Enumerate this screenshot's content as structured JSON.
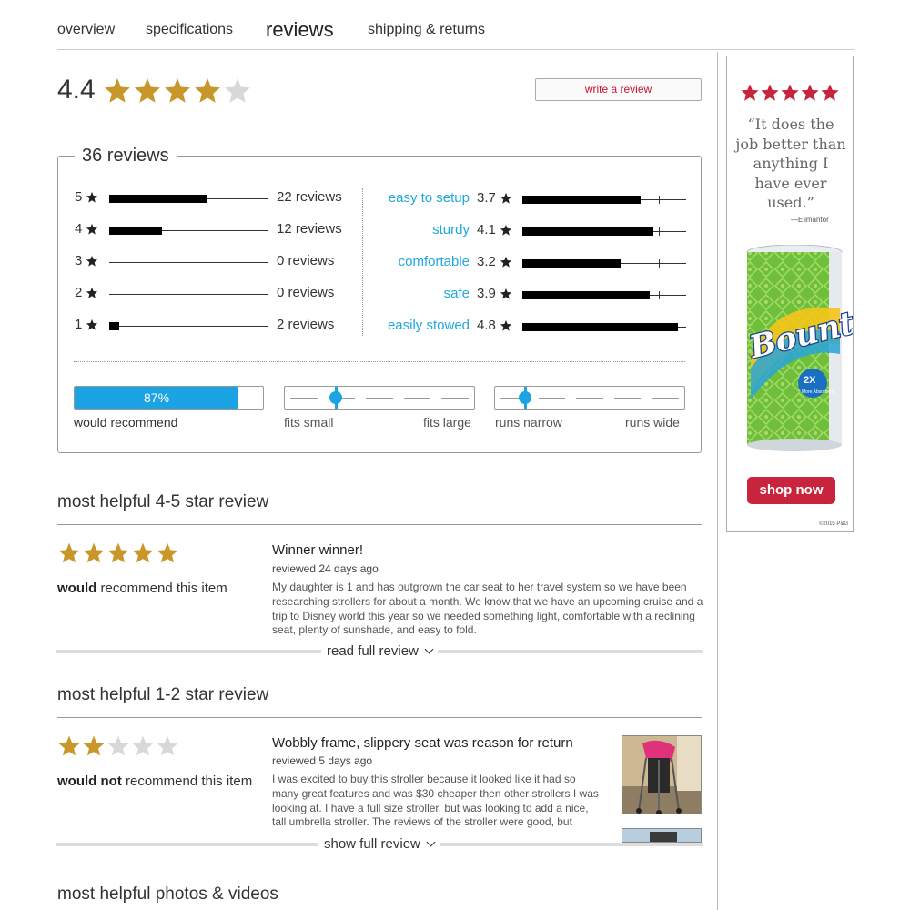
{
  "tabs": [
    "overview",
    "specifications",
    "reviews",
    "shipping & returns"
  ],
  "summary": {
    "average": "4.4",
    "rating": 4,
    "write_review": "write a review"
  },
  "box": {
    "title": "36 reviews",
    "histogram": [
      {
        "stars": "5",
        "count_label": "22 reviews",
        "fraction": 0.61
      },
      {
        "stars": "4",
        "count_label": "12 reviews",
        "fraction": 0.33
      },
      {
        "stars": "3",
        "count_label": "0 reviews",
        "fraction": 0
      },
      {
        "stars": "2",
        "count_label": "0 reviews",
        "fraction": 0
      },
      {
        "stars": "1",
        "count_label": "2 reviews",
        "fraction": 0.06
      }
    ],
    "attributes": [
      {
        "label": "easy to setup",
        "value": "3.7",
        "fraction": 0.72
      },
      {
        "label": "sturdy",
        "value": "4.1",
        "fraction": 0.8
      },
      {
        "label": "comfortable",
        "value": "3.2",
        "fraction": 0.6
      },
      {
        "label": "safe",
        "value": "3.9",
        "fraction": 0.78
      },
      {
        "label": "easily stowed",
        "value": "4.8",
        "fraction": 0.95
      }
    ],
    "recommend": {
      "percent": "87%",
      "fraction": 0.87,
      "label": "would recommend"
    },
    "fit": {
      "left": "fits small",
      "right": "fits large",
      "position": 0.27
    },
    "width": {
      "left": "runs narrow",
      "right": "runs wide",
      "position": 0.16
    }
  },
  "positive_review": {
    "section_title": "most helpful 4-5 star review",
    "rating": 5,
    "recommend_bold": "would",
    "recommend_rest": " recommend this item",
    "title": "Winner winner!",
    "date": "reviewed 24 days ago",
    "body": "My daughter is 1 and has outgrown the car seat to her travel system so we have been researching strollers for about a month. We know that we have an upcoming cruise and a trip to Disney world this year so we needed something light, comfortable with a reclining seat, plenty of sunshade, and easy to fold.",
    "read_more": "read full review"
  },
  "negative_review": {
    "section_title": "most helpful 1-2 star review",
    "rating": 2,
    "recommend_bold": "would not",
    "recommend_rest": " recommend this item",
    "title": "Wobbly frame, slippery seat was reason for return",
    "date": "reviewed 5 days ago",
    "body": "I was excited to buy this stroller because it looked like it had so many great features and was $30 cheaper then other strollers I was looking at. I have a full size stroller, but was looking to add a nice, tall umbrella stroller. The reviews of the stroller were good, but",
    "read_more": "show full review"
  },
  "photos_section": {
    "title": "most helpful photos & videos"
  },
  "ad": {
    "rating": 5,
    "quote": "“It does the job better than anything I have ever used.”",
    "attribution": "—Elimantor",
    "brand": "Bounty",
    "badge_top": "2X",
    "badge_bottom": "More Absorbent",
    "button": "shop now",
    "copyright": "©2015 P&G"
  },
  "colors": {
    "star_gold": "#c9962a",
    "star_gray": "#d8d8d8",
    "link_blue": "#1fa8dc",
    "accent_blue": "#1ba3e3",
    "ad_red": "#c8243d"
  }
}
